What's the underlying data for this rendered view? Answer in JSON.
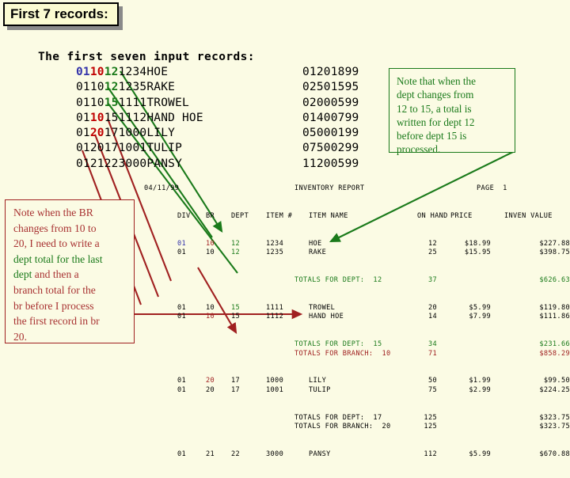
{
  "title": {
    "label": "First 7 records:"
  },
  "records_section": {
    "heading": "The first seven input records:",
    "rows": [
      {
        "div": "01",
        "br": "10",
        "dept": "12",
        "rest": "1234HOE",
        "div_color": "blue",
        "br_color": "red",
        "dept_color": "green",
        "packed": "01201899"
      },
      {
        "div": "01",
        "br": "10",
        "dept": "12",
        "rest": "1235RAKE",
        "div_color": "black",
        "br_color": "black",
        "dept_color": "green",
        "packed": "02501595"
      },
      {
        "div": "01",
        "br": "10",
        "dept": "15",
        "rest": "1111TROWEL",
        "div_color": "black",
        "br_color": "black",
        "dept_color": "green",
        "packed": "02000599"
      },
      {
        "div": "01",
        "br": "10",
        "dept": "15",
        "rest": "1112HAND HOE",
        "div_color": "black",
        "br_color": "red",
        "dept_color": "black",
        "packed": "01400799"
      },
      {
        "div": "01",
        "br": "20",
        "dept": "17",
        "rest": "1000LILY",
        "div_color": "black",
        "br_color": "red",
        "dept_color": "black",
        "packed": "05000199"
      },
      {
        "div": "01",
        "br": "20",
        "dept": "17",
        "rest": "1001TULIP",
        "div_color": "black",
        "br_color": "black",
        "dept_color": "black",
        "packed": "07500299"
      },
      {
        "div": "01",
        "br": "21",
        "dept": "22",
        "rest": "3000PANSY",
        "div_color": "black",
        "br_color": "black",
        "dept_color": "black",
        "packed": "11200599"
      }
    ]
  },
  "callout_green": {
    "lines": [
      "Note that when the",
      "dept changes from",
      "12 to 15, a total is",
      "written for dept 12",
      "before dept 15 is",
      "processed."
    ]
  },
  "callout_red": {
    "line1": "Note when the BR",
    "line2": "changes from  10 to",
    "line3": "20, I need to write a",
    "line4_green": "dept total for the last",
    "line5_green": "dept",
    "line5_red": " and then a",
    "line6": "branch total for the",
    "line7": "br before I process",
    "line8": "the first record in br",
    "line9": "20."
  },
  "report": {
    "date": "04/11/99",
    "report_title": "INVENTORY REPORT",
    "page_label": "PAGE",
    "page_number": "1",
    "columns": {
      "div": "DIV",
      "br": "BR",
      "dept": "DEPT",
      "item_no": "ITEM #",
      "item_name": "ITEM NAME",
      "on_hand": "ON HAND",
      "price": "PRICE",
      "inven_value": "INVEN VALUE"
    },
    "blocks": [
      {
        "detail": [
          {
            "div": "01",
            "br": "10",
            "dept": "12",
            "item_no": "1234",
            "item_name": "HOE",
            "on_hand": "12",
            "price": "$18.99",
            "value": "$227.88",
            "div_color": "blue",
            "br_color": "red",
            "dept_color": "green"
          },
          {
            "div": "01",
            "br": "10",
            "dept": "12",
            "item_no": "1235",
            "item_name": "RAKE",
            "on_hand": "25",
            "price": "$15.95",
            "value": "$398.75",
            "div_color": "black",
            "br_color": "black",
            "dept_color": "green"
          }
        ],
        "totals": [
          {
            "label": "TOTALS FOR DEPT:  12",
            "on_hand": "37",
            "value": "$626.63",
            "color": "green"
          }
        ]
      },
      {
        "detail": [
          {
            "div": "01",
            "br": "10",
            "dept": "15",
            "item_no": "1111",
            "item_name": "TROWEL",
            "on_hand": "20",
            "price": "$5.99",
            "value": "$119.80",
            "div_color": "black",
            "br_color": "black",
            "dept_color": "green"
          },
          {
            "div": "01",
            "br": "10",
            "dept": "15",
            "item_no": "1112",
            "item_name": "HAND HOE",
            "on_hand": "14",
            "price": "$7.99",
            "value": "$111.86",
            "div_color": "black",
            "br_color": "red",
            "dept_color": "black"
          }
        ],
        "totals": [
          {
            "label": "TOTALS FOR DEPT:  15",
            "on_hand": "34",
            "value": "$231.66",
            "color": "green"
          },
          {
            "label": "TOTALS FOR BRANCH:  10",
            "on_hand": "71",
            "value": "$858.29",
            "color": "red"
          }
        ]
      },
      {
        "detail": [
          {
            "div": "01",
            "br": "20",
            "dept": "17",
            "item_no": "1000",
            "item_name": "LILY",
            "on_hand": "50",
            "price": "$1.99",
            "value": "$99.50",
            "div_color": "black",
            "br_color": "red",
            "dept_color": "black"
          },
          {
            "div": "01",
            "br": "20",
            "dept": "17",
            "item_no": "1001",
            "item_name": "TULIP",
            "on_hand": "75",
            "price": "$2.99",
            "value": "$224.25",
            "div_color": "black",
            "br_color": "black",
            "dept_color": "black"
          }
        ],
        "totals": [
          {
            "label": "TOTALS FOR DEPT:  17",
            "on_hand": "125",
            "value": "$323.75",
            "color": "black"
          },
          {
            "label": "TOTALS FOR BRANCH:  20",
            "on_hand": "125",
            "value": "$323.75",
            "color": "black"
          }
        ]
      },
      {
        "detail": [
          {
            "div": "01",
            "br": "21",
            "dept": "22",
            "item_no": "3000",
            "item_name": "PANSY",
            "on_hand": "112",
            "price": "$5.99",
            "value": "$670.88",
            "div_color": "black",
            "br_color": "black",
            "dept_color": "black"
          }
        ],
        "totals": []
      }
    ]
  },
  "colors": {
    "background": "#fbfbe4",
    "green": "#1a7a1a",
    "red": "#a02020",
    "blue": "#3333aa",
    "black": "#000000",
    "title_fill": "#fbfbd2",
    "title_shadow": "#8a8a8a"
  }
}
